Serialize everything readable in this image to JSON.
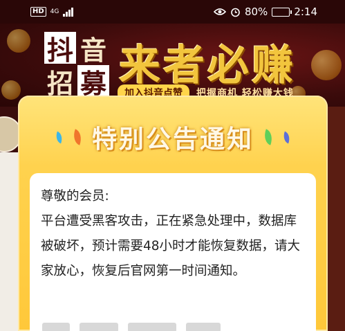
{
  "status_bar": {
    "hd": "HD",
    "network": "4G",
    "battery": "80%",
    "time": "2:14",
    "battery_level": 0.8
  },
  "banner": {
    "logo": [
      "抖",
      "音",
      "招",
      "募"
    ],
    "slogan": "来者必赚",
    "sub_pill": "加入抖音点赞",
    "sub_text": "把握商机 轻松赚大钱"
  },
  "notice": {
    "title": "特别公告通知",
    "greeting": "尊敬的会员:",
    "body": "平台遭受黑客攻击，正在紧急处理中，数据库被破坏，预计需要48小时才能恢复数据，请大家放心，恢复后官网第一时间通知。"
  },
  "colors": {
    "leaf_left_1": "#3cb6e8",
    "leaf_left_2": "#f0752c",
    "leaf_right_1": "#5fcf5a",
    "leaf_right_2": "#5d6fd8"
  }
}
